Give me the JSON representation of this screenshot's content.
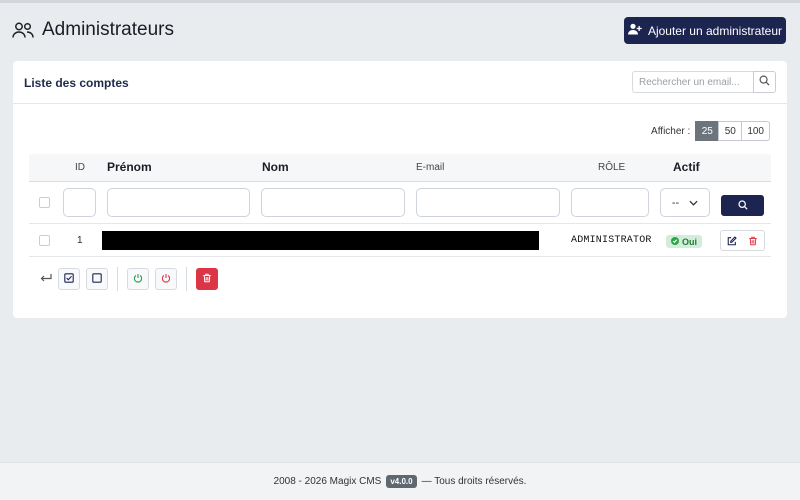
{
  "header": {
    "title": "Administrateurs",
    "add_button_label": "Ajouter un administrateur"
  },
  "card": {
    "title": "Liste des comptes",
    "search_placeholder": "Rechercher un email...",
    "show_label": "Afficher :",
    "page_sizes": [
      "25",
      "50",
      "100"
    ],
    "active_page_size": "25"
  },
  "table": {
    "columns": {
      "id": "ID",
      "first_name": "Prénom",
      "last_name": "Nom",
      "email": "E-mail",
      "role": "RÔLE",
      "active": "Actif"
    },
    "filters": {
      "active_select_value": "--"
    },
    "rows": [
      {
        "id": "1",
        "role": "ADMINISTRATOR",
        "active": "Oui"
      }
    ]
  },
  "footer": {
    "text_before": "2008 - 2026 Magix CMS",
    "version": "v4.0.0",
    "text_after": "— Tous droits réservés."
  },
  "colors": {
    "primary": "#1c2450",
    "danger": "#dc3545",
    "success_bg": "#d4edda",
    "success_text": "#1e7e34",
    "page_bg": "#e9ecef"
  }
}
